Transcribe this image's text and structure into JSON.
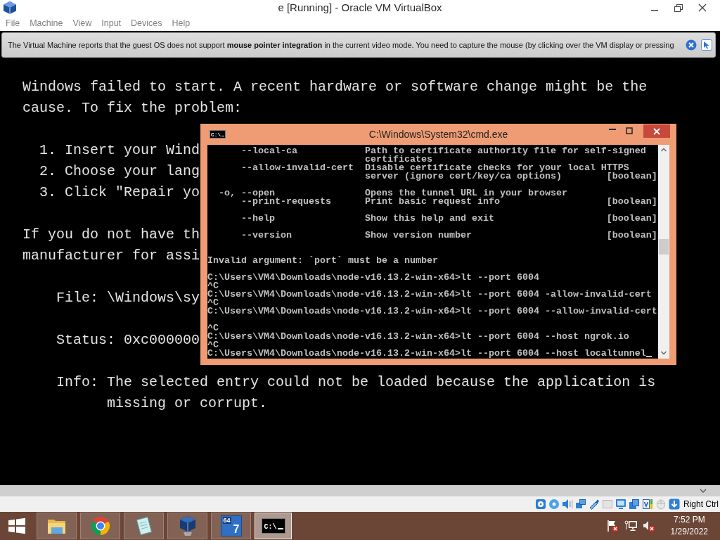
{
  "window": {
    "title": "e [Running] - Oracle VM VirtualBox"
  },
  "menu": [
    "File",
    "Machine",
    "View",
    "Input",
    "Devices",
    "Help"
  ],
  "notification": {
    "text": "The Virtual Machine reports that the guest OS does not support **mouse pointer integration** in the current video mode. You need to capture the mouse (by clicking over the VM display or pressing"
  },
  "boot_screen": {
    "intro": "Windows failed to start. A recent hardware or software change might be the cause. To fix the problem:",
    "steps": [
      "1. Insert your Wind",
      "2. Choose your lang",
      "3. Click \"Repair yo"
    ],
    "note_lines": [
      "If you do not have th",
      "manufacturer for assi"
    ],
    "details": [
      {
        "label": "File:",
        "value": "\\Windows\\sy"
      },
      {
        "label": "Status:",
        "value": "0xc000000"
      },
      {
        "label": "Info:",
        "value": "The selected entry could not be loaded because the application is missing or corrupt."
      }
    ]
  },
  "cmd_window": {
    "title": "C:\\Windows\\System32\\cmd.exe",
    "icon_text": "C:\\",
    "lines": [
      {
        "kind": "text",
        "text": "      --local-ca            Path to certificate authority file for self-signed"
      },
      {
        "kind": "text",
        "text": "                            certificates"
      },
      {
        "kind": "text",
        "text": "      --allow-invalid-cert  Disable certificate checks for your local HTTPS"
      },
      {
        "kind": "text",
        "text": "                            server (ignore cert/key/ca options)        [boolean]"
      },
      {
        "kind": "blank"
      },
      {
        "kind": "text",
        "text": "  -o, --open                Opens the tunnel URL in your browser"
      },
      {
        "kind": "text",
        "text": "      --print-requests      Print basic request info                   [boolean]"
      },
      {
        "kind": "blank"
      },
      {
        "kind": "text",
        "text": "      --help                Show this help and exit                    [boolean]"
      },
      {
        "kind": "blank"
      },
      {
        "kind": "text",
        "text": "      --version             Show version number                        [boolean]"
      },
      {
        "kind": "blank"
      },
      {
        "kind": "blank"
      },
      {
        "kind": "text",
        "text": "Invalid argument: `port` must be a number"
      },
      {
        "kind": "blank"
      },
      {
        "kind": "text",
        "text": "C:\\Users\\VM4\\Downloads\\node-v16.13.2-win-x64>lt --port 6004"
      },
      {
        "kind": "text",
        "text": "^C"
      },
      {
        "kind": "text",
        "text": "C:\\Users\\VM4\\Downloads\\node-v16.13.2-win-x64>lt --port 6004 -allow-invalid-cert"
      },
      {
        "kind": "text",
        "text": "^C"
      },
      {
        "kind": "text",
        "text": "C:\\Users\\VM4\\Downloads\\node-v16.13.2-win-x64>lt --port 6004 --allow-invalid-cert"
      },
      {
        "kind": "blank"
      },
      {
        "kind": "text",
        "text": "^C"
      },
      {
        "kind": "text",
        "text": "C:\\Users\\VM4\\Downloads\\node-v16.13.2-win-x64>lt --port 6004 --host ngrok.io"
      },
      {
        "kind": "text",
        "text": "^C"
      },
      {
        "kind": "text",
        "text": "C:\\Users\\VM4\\Downloads\\node-v16.13.2-win-x64>lt --port 6004 --host localtunnel",
        "cursor": true
      }
    ]
  },
  "status_bar": {
    "host_key": "Right Ctrl"
  },
  "taskbar": {
    "apps": [
      {
        "kind": "folder",
        "selected": false
      },
      {
        "kind": "ring",
        "selected": false
      },
      {
        "kind": "notepad",
        "selected": false
      },
      {
        "kind": "cube",
        "selected": false
      },
      {
        "kind": "tile",
        "marks": [
          "64",
          "7"
        ],
        "selected": false
      },
      {
        "kind": "console",
        "icon_text": "C:\\",
        "selected": true
      }
    ],
    "clock": {
      "time": "7:52 PM",
      "date": "1/29/2022"
    }
  }
}
